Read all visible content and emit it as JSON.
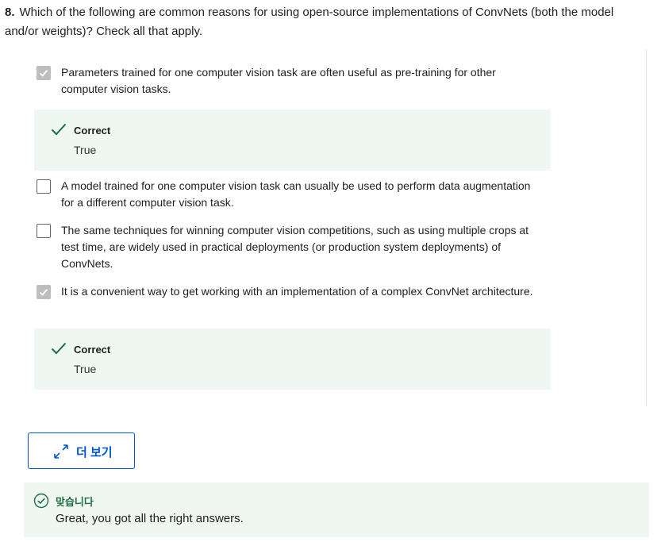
{
  "question": {
    "number": "8.",
    "text": "Which of the following are common reasons for using open-source implementations of ConvNets (both the model and/or weights)? Check all that apply."
  },
  "options": [
    {
      "text": "Parameters trained for one computer vision task are often useful as pre-training for other computer vision tasks.",
      "checked": true,
      "feedback": {
        "title": "Correct",
        "body": "True"
      }
    },
    {
      "text": "A model trained for one computer vision task can usually be used to perform data augmentation for a different computer vision task.",
      "checked": false
    },
    {
      "text": "The same techniques for winning computer vision competitions, such as using multiple crops at test time, are widely used in practical deployments (or production system deployments) of ConvNets.",
      "checked": false
    },
    {
      "text": "It is a convenient way to get working with an implementation of a complex ConvNet architecture.",
      "checked": true,
      "feedback": {
        "title": "Correct",
        "body": "True"
      }
    }
  ],
  "more_button": {
    "label": "더 보기",
    "icon": "expand-icon"
  },
  "result": {
    "title": "맞습니다",
    "message": "Great, you got all the right answers.",
    "icon": "check-circle-icon"
  },
  "colors": {
    "accent": "#0056d2",
    "success": "#1f6e43",
    "feedback_bg": "#eef7f2",
    "checkbox_checked": "#bdbdbd"
  }
}
